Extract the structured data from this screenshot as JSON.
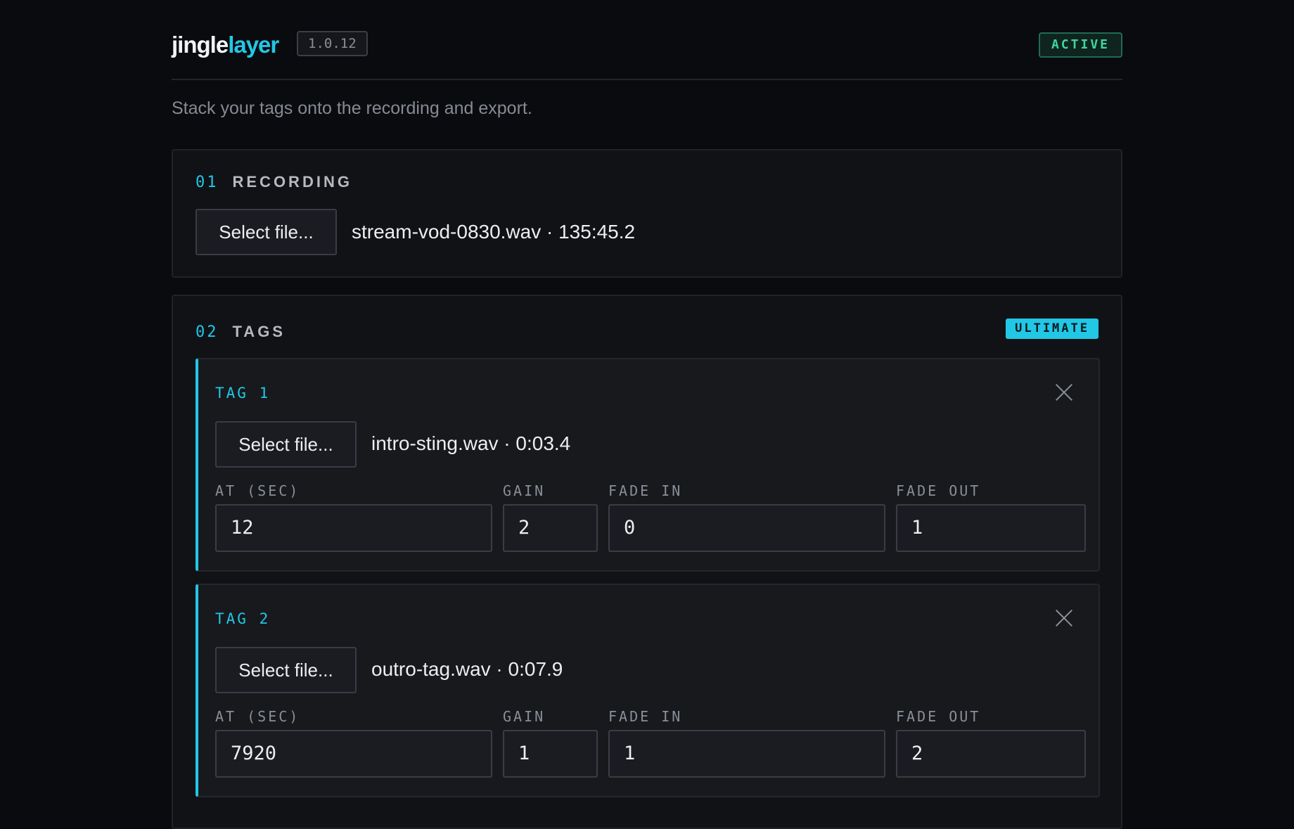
{
  "app": {
    "logo_part1": "jingle",
    "logo_part2": "layer",
    "version": "1.0.12",
    "status": "ACTIVE",
    "tagline": "Stack your tags onto the recording and export."
  },
  "recording": {
    "number": "01",
    "title": "RECORDING",
    "button_label": "Select file...",
    "file_info": "stream-vod-0830.wav · 135:45.2"
  },
  "tags_section": {
    "number": "02",
    "title": "TAGS",
    "plan_badge": "ULTIMATE",
    "labels": {
      "at": "AT (SEC)",
      "gain": "GAIN",
      "fade_in": "FADE IN",
      "fade_out": "FADE OUT"
    },
    "tags": [
      {
        "title": "TAG 1",
        "button_label": "Select file...",
        "file_info": "intro-sting.wav · 0:03.4",
        "at": "12",
        "gain": "2",
        "fade_in": "0",
        "fade_out": "1"
      },
      {
        "title": "TAG 2",
        "button_label": "Select file...",
        "file_info": "outro-tag.wav · 0:07.9",
        "at": "7920",
        "gain": "1",
        "fade_in": "1",
        "fade_out": "2"
      }
    ]
  }
}
